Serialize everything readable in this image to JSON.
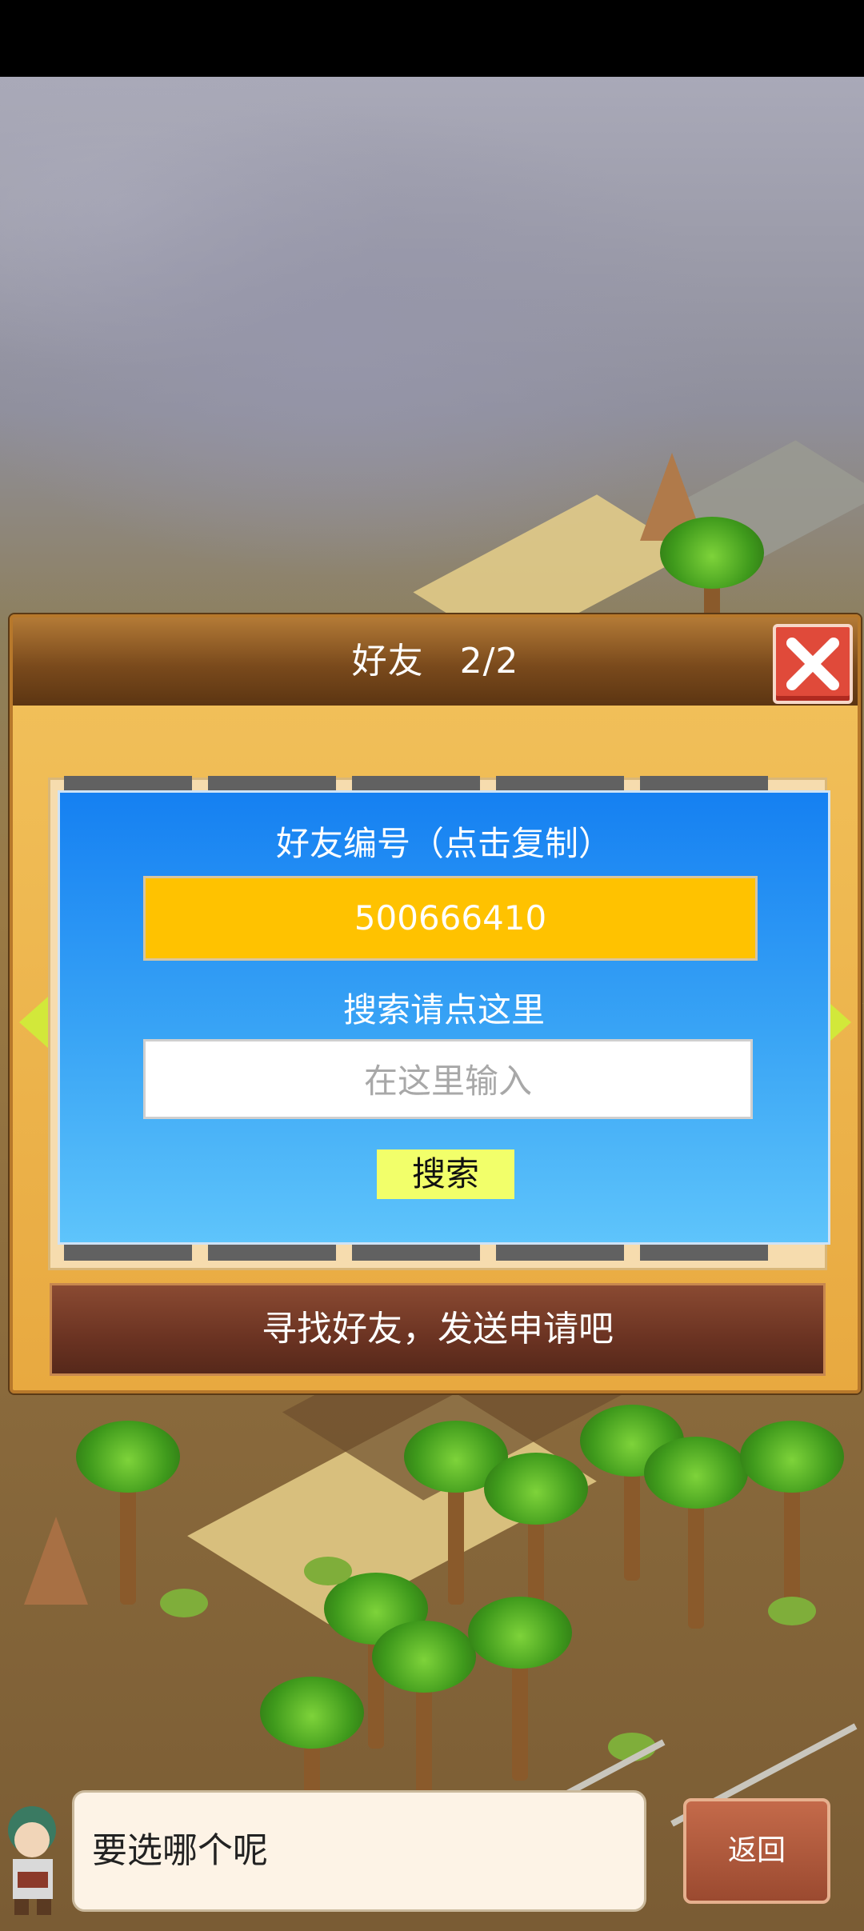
{
  "dialog": {
    "title": "好友　2/2",
    "friend_code_label": "好友编号（点击复制）",
    "friend_code": "500666410",
    "search_label": "搜索请点这里",
    "search_placeholder": "在这里输入",
    "search_button": "搜索",
    "hint": "寻找好友，发送申请吧"
  },
  "footer": {
    "message": "要选哪个呢",
    "back_button": "返回"
  },
  "colors": {
    "panel_blue": "#1580f2",
    "code_yellow": "#ffc200",
    "close_red": "#e04a3a",
    "nav_arrow": "#d2e83a"
  },
  "icons": [
    "close-icon",
    "arrow-left-icon",
    "arrow-right-icon"
  ]
}
